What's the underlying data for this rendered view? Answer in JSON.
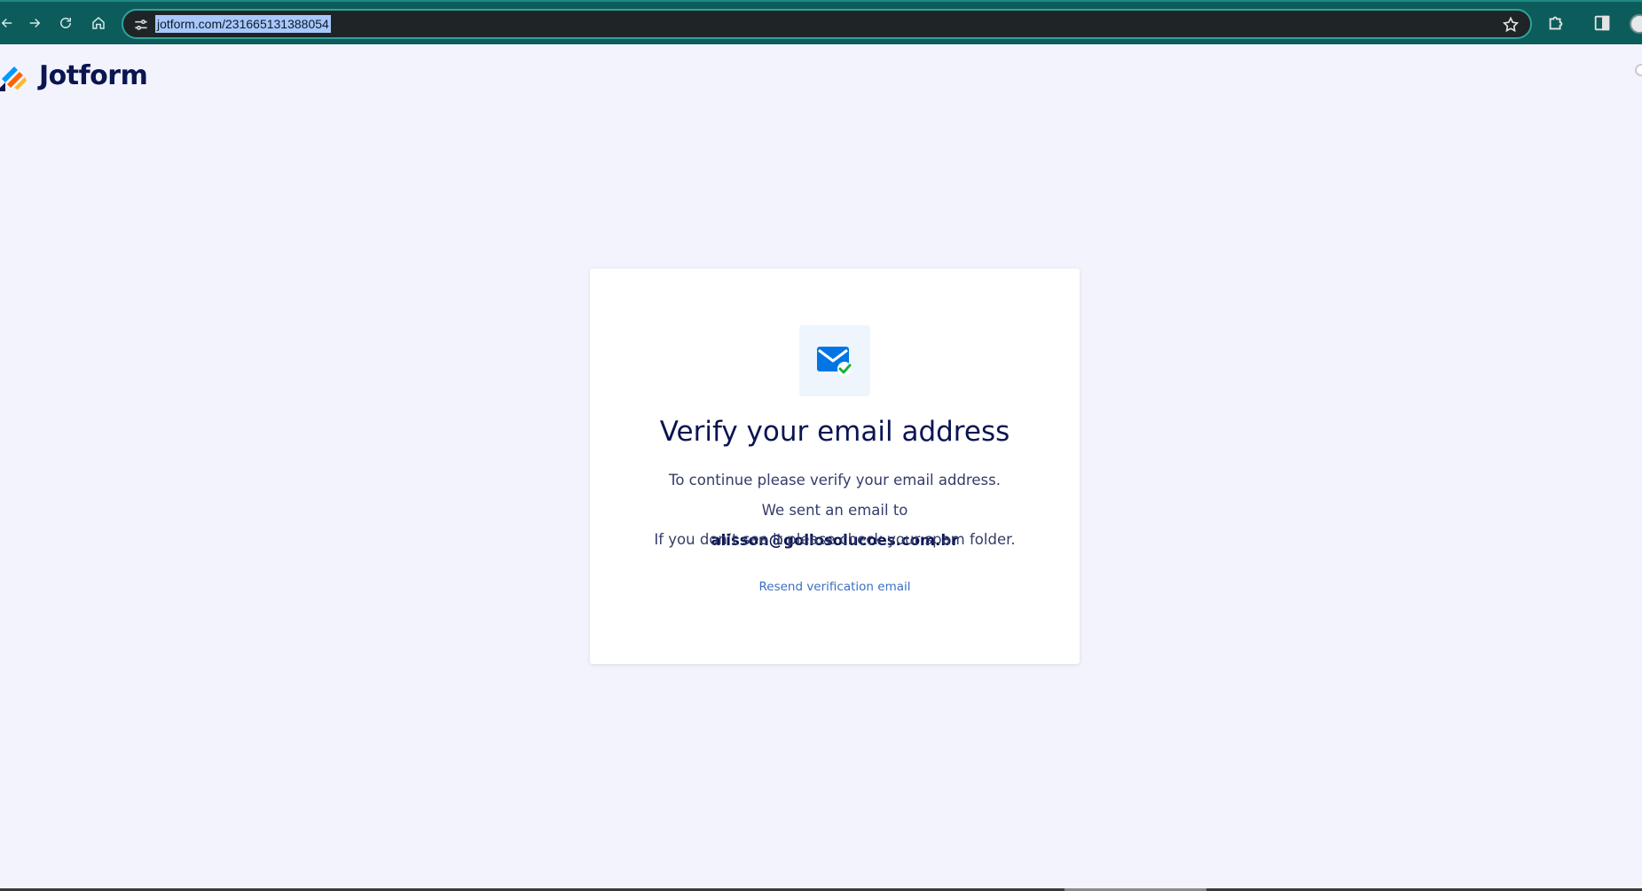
{
  "browser": {
    "url": "jotform.com/231665131388054"
  },
  "header": {
    "logo_text": "Jotform"
  },
  "card": {
    "title": "Verify your email address",
    "body_prefix": "To continue please verify your email address. We sent an email to",
    "email": "alisson@gollosolucoes.com.br",
    "spam_note": "If you don’t see it please check your spam folder.",
    "resend_label": "Resend verification email"
  },
  "colors": {
    "brand_navy": "#0a1551",
    "link_blue": "#3a6fc4",
    "page_bg": "#f3f3fd",
    "chrome_teal": "#0d5c5c"
  }
}
